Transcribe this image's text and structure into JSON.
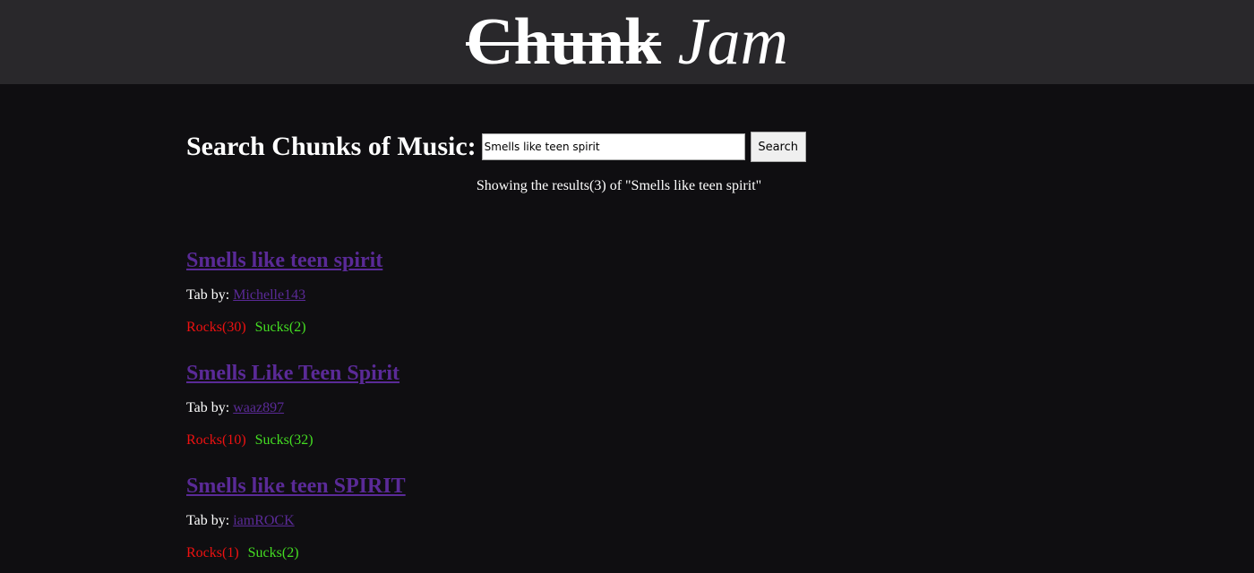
{
  "header": {
    "logo_part1": "Chunk",
    "logo_part2": "Jam",
    "background": "#29282b"
  },
  "search": {
    "label": "Search Chunks of Music:",
    "value": "Smells like teen spirit",
    "button_label": "Search",
    "summary": "Showing the results(3) of \"Smells like teen spirit\""
  },
  "colors": {
    "page_background": "#0f0e11",
    "link": "#5a2a97",
    "rocks": "#ee1111",
    "sucks": "#44dd22"
  },
  "results": [
    {
      "title": "Smells like teen spirit",
      "tab_by_label": "Tab by:",
      "author": "Michelle143",
      "rocks": "Rocks(30)",
      "sucks": "Sucks(2)"
    },
    {
      "title": "Smells Like Teen Spirit",
      "tab_by_label": "Tab by:",
      "author": "waaz897",
      "rocks": "Rocks(10)",
      "sucks": "Sucks(32)"
    },
    {
      "title": "Smells like teen SPIRIT",
      "tab_by_label": "Tab by:",
      "author": "iamROCK",
      "rocks": "Rocks(1)",
      "sucks": "Sucks(2)"
    }
  ]
}
